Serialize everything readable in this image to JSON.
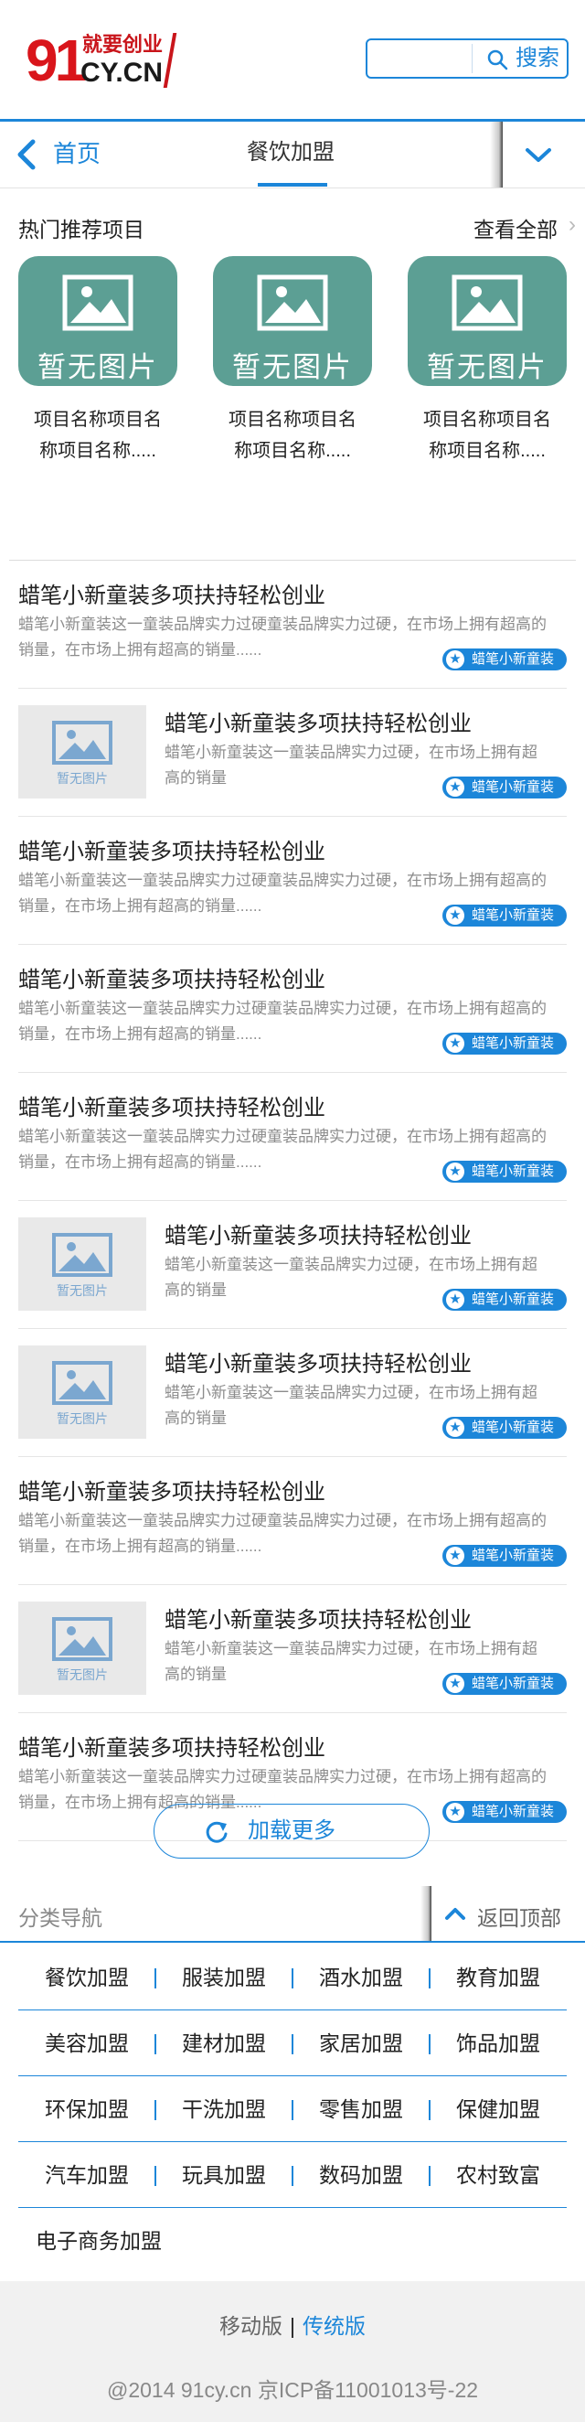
{
  "header": {
    "logo_number": "91",
    "logo_tagline": "就要创业",
    "logo_domain": "CY.CN",
    "search_placeholder": "",
    "search_label": "搜索"
  },
  "nav": {
    "home_label": "首页",
    "title": "餐饮加盟"
  },
  "hot": {
    "title": "热门推荐项目",
    "view_all": "查看全部",
    "items": [
      {
        "placeholder": "暂无图片",
        "name": "项目名称项目名称项目名称....."
      },
      {
        "placeholder": "暂无图片",
        "name": "项目名称项目名称项目名称....."
      },
      {
        "placeholder": "暂无图片",
        "name": "项目名称项目名称项目名称....."
      }
    ]
  },
  "list": {
    "items": [
      {
        "has_image": false,
        "title": "蜡笔小新童装多项扶持轻松创业",
        "desc": "蜡笔小新童装这一童装品牌实力过硬童装品牌实力过硬，在市场上拥有超高的销量，在市场上拥有超高的销量......",
        "tag": "蜡笔小新童装"
      },
      {
        "has_image": true,
        "image_placeholder": "暂无图片",
        "title": "蜡笔小新童装多项扶持轻松创业",
        "desc": "蜡笔小新童装这一童装品牌实力过硬，在市场上拥有超高的销量",
        "tag": "蜡笔小新童装"
      },
      {
        "has_image": false,
        "title": "蜡笔小新童装多项扶持轻松创业",
        "desc": "蜡笔小新童装这一童装品牌实力过硬童装品牌实力过硬，在市场上拥有超高的销量，在市场上拥有超高的销量......",
        "tag": "蜡笔小新童装"
      },
      {
        "has_image": false,
        "title": "蜡笔小新童装多项扶持轻松创业",
        "desc": "蜡笔小新童装这一童装品牌实力过硬童装品牌实力过硬，在市场上拥有超高的销量，在市场上拥有超高的销量......",
        "tag": "蜡笔小新童装"
      },
      {
        "has_image": false,
        "title": "蜡笔小新童装多项扶持轻松创业",
        "desc": "蜡笔小新童装这一童装品牌实力过硬童装品牌实力过硬，在市场上拥有超高的销量，在市场上拥有超高的销量......",
        "tag": "蜡笔小新童装"
      },
      {
        "has_image": true,
        "image_placeholder": "暂无图片",
        "title": "蜡笔小新童装多项扶持轻松创业",
        "desc": "蜡笔小新童装这一童装品牌实力过硬，在市场上拥有超高的销量",
        "tag": "蜡笔小新童装"
      },
      {
        "has_image": true,
        "image_placeholder": "暂无图片",
        "title": "蜡笔小新童装多项扶持轻松创业",
        "desc": "蜡笔小新童装这一童装品牌实力过硬，在市场上拥有超高的销量",
        "tag": "蜡笔小新童装"
      },
      {
        "has_image": false,
        "title": "蜡笔小新童装多项扶持轻松创业",
        "desc": "蜡笔小新童装这一童装品牌实力过硬童装品牌实力过硬，在市场上拥有超高的销量，在市场上拥有超高的销量......",
        "tag": "蜡笔小新童装"
      },
      {
        "has_image": true,
        "image_placeholder": "暂无图片",
        "title": "蜡笔小新童装多项扶持轻松创业",
        "desc": "蜡笔小新童装这一童装品牌实力过硬，在市场上拥有超高的销量",
        "tag": "蜡笔小新童装"
      },
      {
        "has_image": false,
        "title": "蜡笔小新童装多项扶持轻松创业",
        "desc": "蜡笔小新童装这一童装品牌实力过硬童装品牌实力过硬，在市场上拥有超高的销量，在市场上拥有超高的销量......",
        "tag": "蜡笔小新童装"
      }
    ],
    "load_more": "加载更多"
  },
  "category": {
    "title": "分类导航",
    "back_top": "返回顶部",
    "rows": [
      [
        "餐饮加盟",
        "服装加盟",
        "酒水加盟",
        "教育加盟"
      ],
      [
        "美容加盟",
        "建材加盟",
        "家居加盟",
        "饰品加盟"
      ],
      [
        "环保加盟",
        "干洗加盟",
        "零售加盟",
        "保健加盟"
      ],
      [
        "汽车加盟",
        "玩具加盟",
        "数码加盟",
        "农村致富"
      ],
      [
        "电子商务加盟"
      ]
    ]
  },
  "footer": {
    "mobile": "移动版",
    "separator": "|",
    "classic": "传统版",
    "copyright": "@2014 91cy.cn 京ICP备11001013号-22"
  },
  "colors": {
    "accent": "#1c86d9",
    "brand_red": "#d9151b",
    "thumb_teal": "#5c9f94"
  }
}
